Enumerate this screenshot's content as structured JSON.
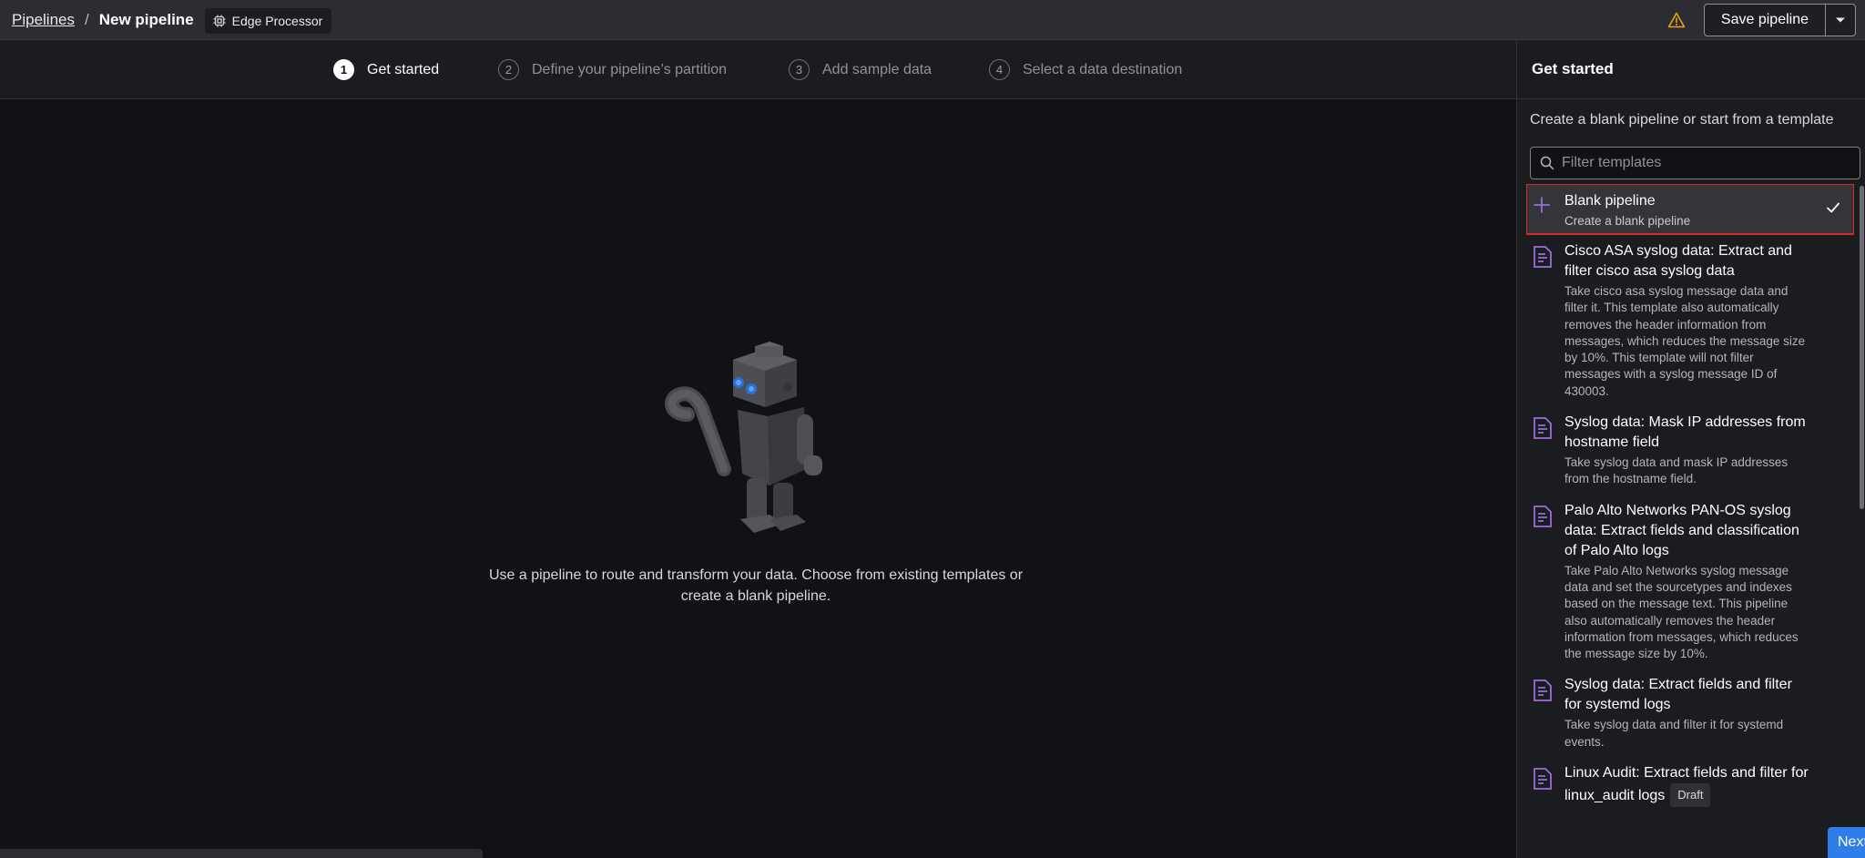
{
  "topbar": {
    "breadcrumb_root": "Pipelines",
    "breadcrumb_sep": "/",
    "breadcrumb_current": "New pipeline",
    "badge_label": "Edge Processor",
    "save_label": "Save pipeline",
    "warning_icon": "warning-triangle-icon"
  },
  "stepper": {
    "steps": [
      {
        "num": "1",
        "label": "Get started",
        "active": true
      },
      {
        "num": "2",
        "label": "Define your pipeline’s partition",
        "active": false
      },
      {
        "num": "3",
        "label": "Add sample data",
        "active": false
      },
      {
        "num": "4",
        "label": "Select a data destination",
        "active": false
      }
    ]
  },
  "canvas": {
    "message": "Use a pipeline to route and transform your data. Choose from existing templates or create a blank pipeline."
  },
  "panel": {
    "title": "Get started",
    "subtitle": "Create a blank pipeline or start from a template",
    "filter_placeholder": "Filter templates",
    "templates": [
      {
        "title": "Blank pipeline",
        "desc": "Create a blank pipeline",
        "icon": "plus-icon",
        "selected": true
      },
      {
        "title": "Cisco ASA syslog data: Extract and filter cisco asa syslog data",
        "desc": "Take cisco asa syslog message data and filter it. This template also automatically removes the header information from messages, which reduces the message size by 10%. This template will not filter messages with a syslog message ID of 430003.",
        "icon": "document-icon"
      },
      {
        "title": "Syslog data: Mask IP addresses from hostname field",
        "desc": "Take syslog data and mask IP addresses from the hostname field.",
        "icon": "document-icon"
      },
      {
        "title": "Palo Alto Networks PAN-OS syslog data: Extract fields and classification of Palo Alto logs",
        "desc": "Take Palo Alto Networks syslog message data and set the sourcetypes and indexes based on the message text. This pipeline also automatically removes the header information from messages, which reduces the message size by 10%.",
        "icon": "document-icon"
      },
      {
        "title": "Syslog data: Extract fields and filter for systemd logs",
        "desc": "Take syslog data and filter it for systemd events.",
        "icon": "document-icon"
      },
      {
        "title": "Linux Audit: Extract fields and filter for linux_audit logs",
        "desc": "",
        "badge": "Draft",
        "icon": "document-icon"
      }
    ],
    "next_label": "Next"
  },
  "colors": {
    "accent": "#2f7de8",
    "template_icon": "#9b6fd6",
    "selection_outline": "#d32b2b"
  }
}
